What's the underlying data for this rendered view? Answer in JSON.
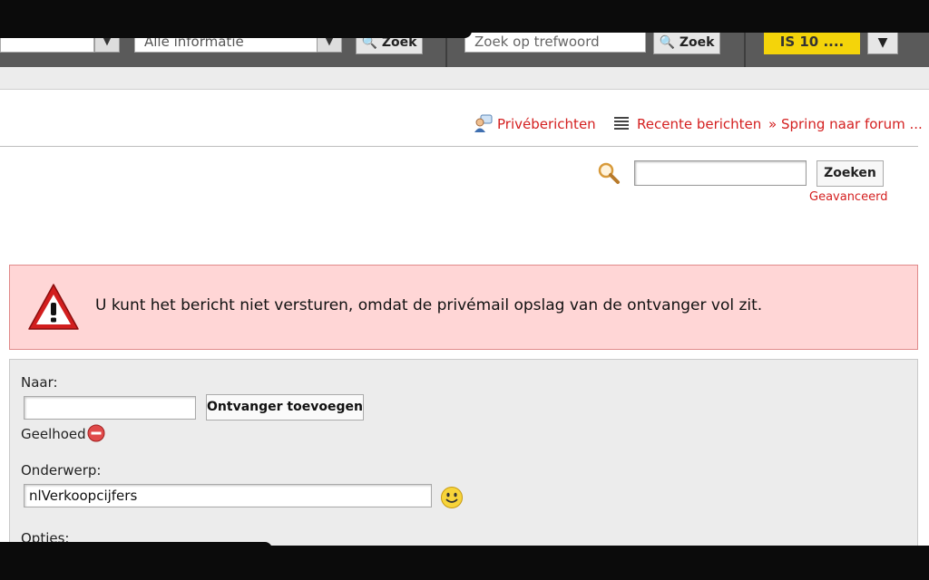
{
  "toolbar": {
    "select_value": "Alle informatie",
    "zoek1_label": "Zoek",
    "search_placeholder": "Zoek op trefwoord",
    "zoek2_label": "Zoek",
    "yellow_label": "IS 10 ...."
  },
  "nav": {
    "private_messages": "Privéberichten",
    "recent_posts": "Recente berichten",
    "jump_to_forum": "» Spring naar forum ..."
  },
  "search": {
    "value": "",
    "button": "Zoeken",
    "advanced": "Geavanceerd"
  },
  "alert": {
    "message": "U kunt het bericht niet versturen, omdat de privémail opslag van de ontvanger vol zit."
  },
  "form": {
    "to_label": "Naar:",
    "to_value": "",
    "add_recipient_button": "Ontvanger toevoegen",
    "recipient_name": "Geelhoed",
    "subject_label": "Onderwerp:",
    "subject_value": "nlVerkoopcijfers",
    "options_label": "Opties:"
  },
  "colors": {
    "link_red": "#d42020",
    "alert_bg": "#ffd6d6",
    "form_bg": "#ececec"
  }
}
